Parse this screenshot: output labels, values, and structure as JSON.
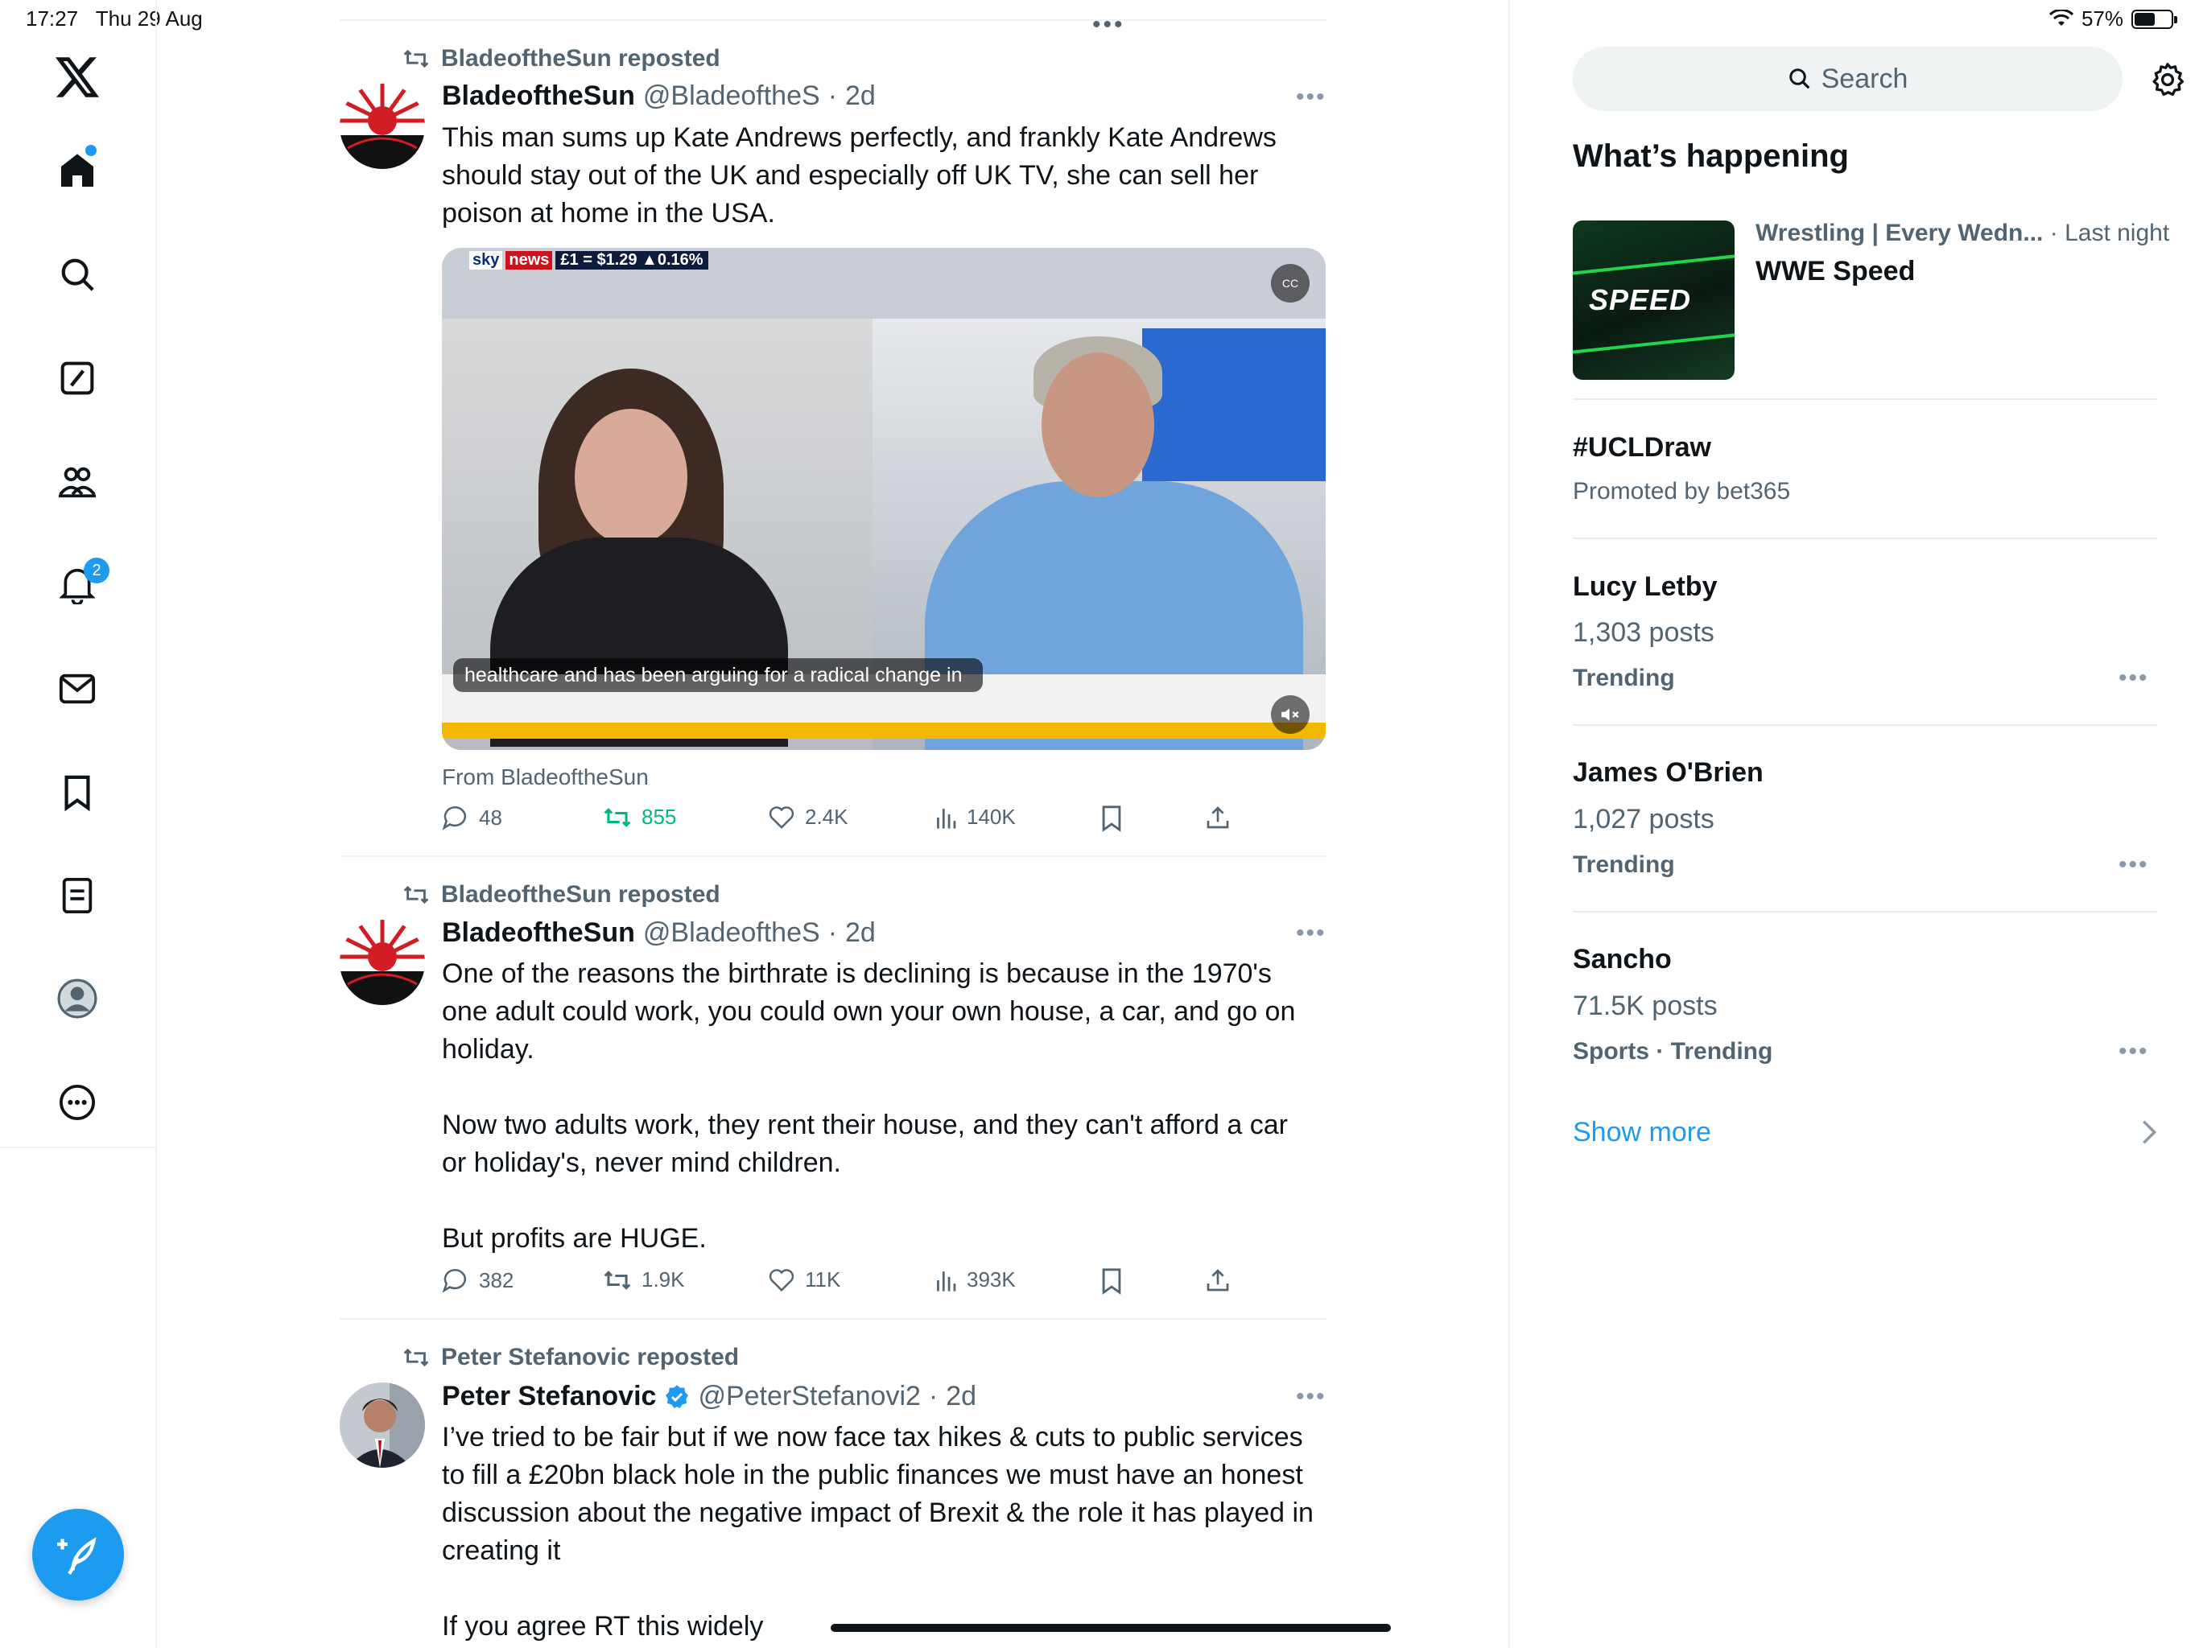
{
  "status_bar": {
    "time": "17:27",
    "date": "Thu 29 Aug",
    "battery": "57%",
    "battery_level": 0.57
  },
  "nav": {
    "logo": "x-logo-icon",
    "items": [
      {
        "name": "home",
        "icon": "home-icon",
        "active": true
      },
      {
        "name": "explore",
        "icon": "search-icon"
      },
      {
        "name": "grok",
        "icon": "grok-icon"
      },
      {
        "name": "communities",
        "icon": "communities-icon"
      },
      {
        "name": "notifications",
        "icon": "bell-icon",
        "badge": "2"
      },
      {
        "name": "messages",
        "icon": "mail-icon"
      },
      {
        "name": "bookmarks",
        "icon": "bookmark-icon"
      },
      {
        "name": "lists",
        "icon": "list-icon"
      },
      {
        "name": "profile",
        "icon": "profile-icon"
      },
      {
        "name": "more",
        "icon": "more-circle-icon"
      }
    ],
    "compose_icon": "compose-icon"
  },
  "feed": {
    "tweets": [
      {
        "repost_label": "BladeoftheSun reposted",
        "name": "BladeoftheSun",
        "handle": "@BladeoftheS",
        "sep": "·",
        "time": "2d",
        "text": "This man sums up Kate Andrews perfectly, and frankly Kate Andrews should stay out of the UK and especially off UK TV, she can sell her poison at home in the USA.",
        "media": {
          "channel_sky": "sky",
          "channel_news": "news",
          "ticker": "£1 = $1.29  ▲0.16%",
          "caption": "healthcare and has been arguing for a radical change in",
          "cc_label": "CC"
        },
        "from_label": "From BladeoftheSun",
        "replies": "48",
        "reposts": "855",
        "likes": "2.4K",
        "views": "140K"
      },
      {
        "repost_label": "BladeoftheSun reposted",
        "name": "BladeoftheSun",
        "handle": "@BladeoftheS",
        "sep": "·",
        "time": "2d",
        "text": "One of the reasons the birthrate is declining is because in the 1970's one adult could work, you could own your own house, a car, and go on holiday.\n\nNow two adults work, they rent their house, and they can't afford a car or holiday's, never mind children.\n\nBut profits are HUGE.",
        "replies": "382",
        "reposts": "1.9K",
        "likes": "11K",
        "views": "393K"
      },
      {
        "repost_label": "Peter Stefanovic reposted",
        "name": "Peter Stefanovic",
        "handle": "@PeterStefanovi2",
        "sep": "·",
        "time": "2d",
        "verified": true,
        "text": "I’ve tried to be fair but if we now face tax hikes & cuts to public services to fill a £20bn black hole in the public finances we must have an honest discussion about the negative impact of Brexit & the role it has played in creating it\n\nIf you agree RT this widely"
      }
    ]
  },
  "sidebar": {
    "search_placeholder": "Search",
    "title": "What’s happening",
    "featured": {
      "meta": "Wrestling | Every Wedn...",
      "meta_sep": "·",
      "meta_time": "Last night",
      "title": "WWE Speed",
      "thumb_text": "SPEED"
    },
    "promoted": {
      "tag": "#UCLDraw",
      "by": "Promoted by bet365"
    },
    "trends": [
      {
        "name": "Lucy Letby",
        "count": "1,303 posts",
        "category": "Trending"
      },
      {
        "name": "James O'Brien",
        "count": "1,027 posts",
        "category": "Trending"
      },
      {
        "name": "Sancho",
        "count": "71.5K posts",
        "category": "Sports · Trending"
      }
    ],
    "show_more": "Show more"
  },
  "colors": {
    "accent": "#1d9bf0",
    "repost_active": "#00ba7c",
    "text": "#0f1419",
    "muted": "#536471"
  }
}
